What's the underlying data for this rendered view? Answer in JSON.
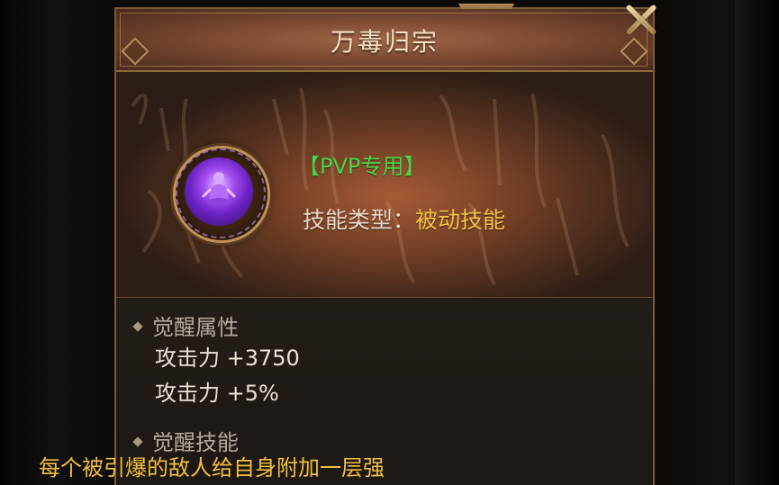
{
  "dialog": {
    "title": "万毒归宗",
    "tag": "【PVP专用】",
    "skill_type_label": "技能类型：",
    "skill_type_value": "被动技能"
  },
  "awakening_attributes": {
    "header": "觉醒属性",
    "stats": [
      "攻击力 +3750",
      "攻击力 +5%"
    ]
  },
  "awakening_skill": {
    "header": "觉醒技能",
    "description": "每个被引爆的敌人给自身附加一层强"
  },
  "icons": {
    "close": "close-icon",
    "bullet": "diamond-icon",
    "skill": "skill-emblem-icon"
  },
  "colors": {
    "pvp_green": "#47d64a",
    "gold": "#f3c145",
    "panel_border": "#7a5a34",
    "header_brown": "#7c4a31",
    "emblem_purple": "#a24df0"
  }
}
